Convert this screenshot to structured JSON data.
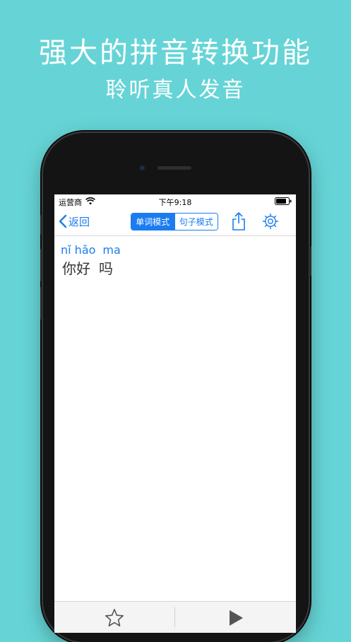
{
  "banner": {
    "title": "强大的拼音转换功能",
    "subtitle": "聆听真人发音"
  },
  "status_bar": {
    "carrier": "运营商",
    "time": "下午9:18",
    "icons": [
      "wifi-icon",
      "battery-icon"
    ]
  },
  "nav": {
    "back_label": "返回",
    "modes": [
      {
        "label": "单词模式",
        "selected": true
      },
      {
        "label": "句子模式",
        "selected": false
      }
    ],
    "icons": [
      "share-icon",
      "gear-icon"
    ]
  },
  "result": {
    "words": [
      {
        "pinyin": "nǐ hǎo",
        "hanzi": "你好"
      },
      {
        "pinyin": "ma",
        "hanzi": "吗"
      }
    ]
  },
  "toolbar": {
    "icons": [
      "star-icon",
      "play-icon"
    ]
  },
  "colors": {
    "background": "#66d4d6",
    "accent": "#1a7cf0"
  }
}
